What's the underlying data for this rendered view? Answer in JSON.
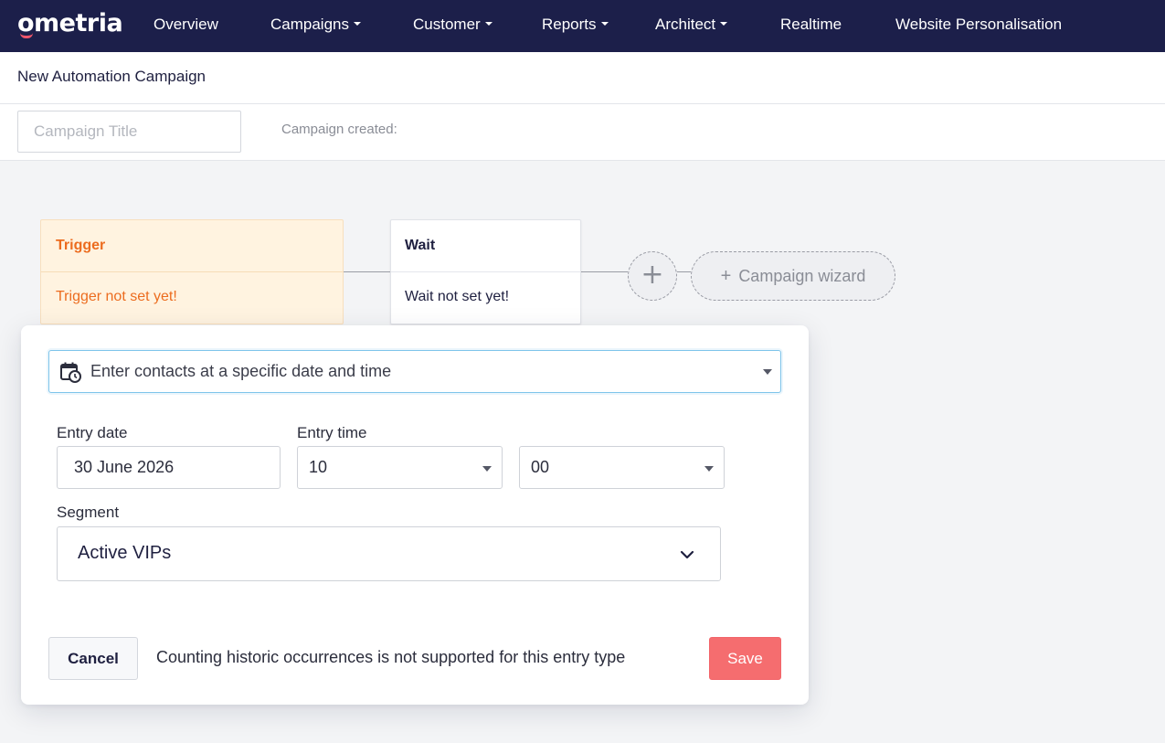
{
  "brand": {
    "logo_text": "ometria",
    "nav_bg": "#1c1f4a",
    "accent": "#f56d6f"
  },
  "nav": {
    "items": [
      {
        "label": "Overview",
        "has_dropdown": false
      },
      {
        "label": "Campaigns",
        "has_dropdown": true
      },
      {
        "label": "Customer",
        "has_dropdown": true
      },
      {
        "label": "Reports",
        "has_dropdown": true
      },
      {
        "label": "Architect",
        "has_dropdown": true
      },
      {
        "label": "Realtime",
        "has_dropdown": false
      },
      {
        "label": "Website Personalisation",
        "has_dropdown": false
      }
    ]
  },
  "page": {
    "title": "New Automation Campaign",
    "campaign_title_placeholder": "Campaign Title",
    "campaign_title_value": "",
    "created_label": "Campaign created:"
  },
  "flow": {
    "trigger": {
      "title": "Trigger",
      "status": "Trigger not set yet!",
      "color": "#ec6c1f"
    },
    "wait": {
      "title": "Wait",
      "status": "Wait not set yet!"
    },
    "add_step_icon": "plus-icon",
    "wizard_label": "Campaign wizard"
  },
  "panel": {
    "entry_type": {
      "icon": "calendar-clock-icon",
      "selected": "Enter contacts at a specific date and time"
    },
    "entry_date": {
      "label": "Entry date",
      "value": "30 June 2026"
    },
    "entry_time": {
      "label": "Entry time",
      "hour": "10",
      "minute": "00"
    },
    "segment": {
      "label": "Segment",
      "selected": "Active VIPs"
    },
    "cancel_label": "Cancel",
    "note": "Counting historic occurrences is not supported for this entry type",
    "save_label": "Save"
  }
}
